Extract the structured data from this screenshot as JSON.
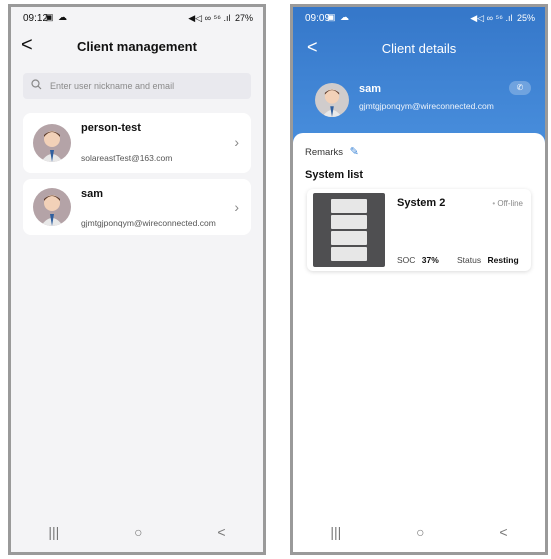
{
  "screen1": {
    "status": {
      "time": "09:12",
      "icons_left": "▣ ☁",
      "icons_right": "◀◁ ∞ ⁵⁶ .ıl",
      "battery": "27%"
    },
    "header": {
      "back": "<",
      "title": "Client management"
    },
    "search": {
      "placeholder": "Enter user nickname and email",
      "value": ""
    },
    "clients": [
      {
        "name": "person-test",
        "email": "solareastTest@163.com"
      },
      {
        "name": "sam",
        "email": "gjmtgjponqym@wireconnected.com"
      }
    ],
    "nav": {
      "recents": "|||",
      "home": "○",
      "back": "<"
    }
  },
  "screen2": {
    "status": {
      "time": "09:09",
      "icons_left": "▣ ☁",
      "icons_right": "◀◁ ∞ ⁵⁶ .ıl",
      "battery": "25%"
    },
    "header": {
      "back": "<",
      "title": "Client details"
    },
    "client": {
      "name": "sam",
      "email": "gjmtgjponqym@wireconnected.com"
    },
    "remarks_label": "Remarks",
    "system_list_title": "System list",
    "system": {
      "name": "System 2",
      "status": "Off-line",
      "soc_label": "SOC",
      "soc_value": "37%",
      "state_label": "Status",
      "state_value": "Resting"
    },
    "nav": {
      "recents": "|||",
      "home": "○",
      "back": "<"
    }
  },
  "colors": {
    "header_blue": "#3577c9",
    "accent": "#3b84d6",
    "card_bg": "#ffffff",
    "page_bg": "#f4f4f6"
  },
  "icons": {
    "search": "search-icon",
    "edit": "edit-icon",
    "phone": "phone-icon",
    "chevron": "chevron-right-icon"
  }
}
